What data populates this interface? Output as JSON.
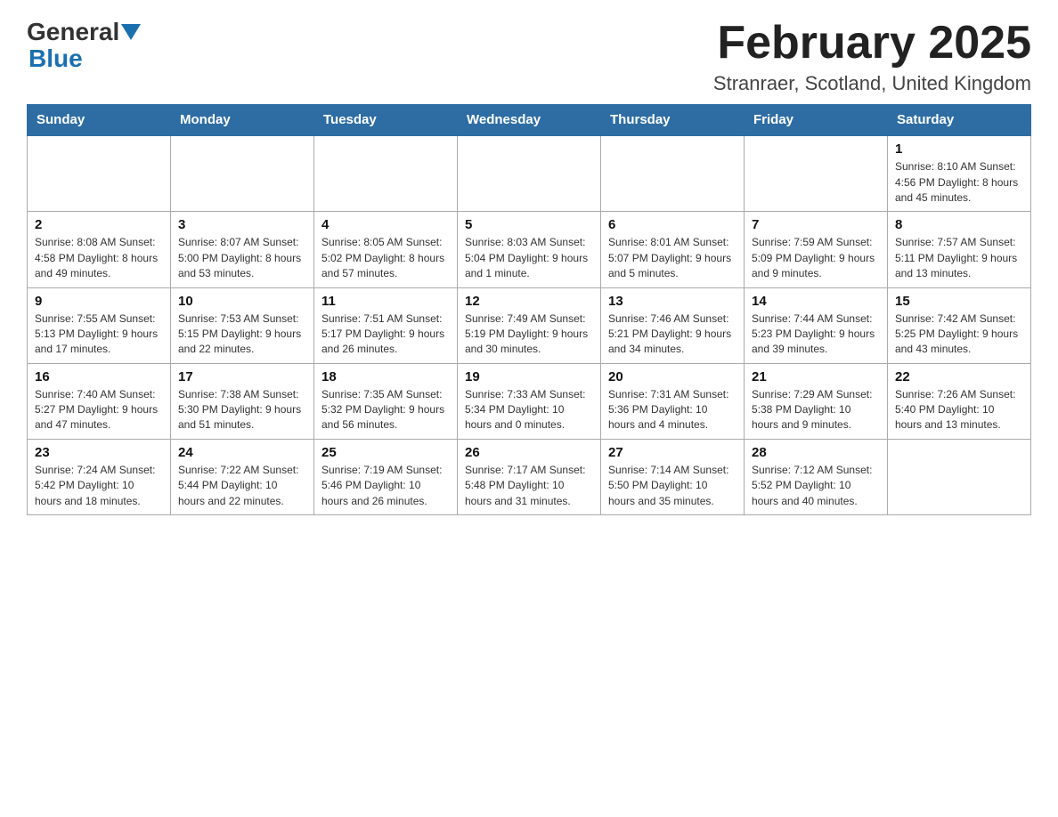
{
  "header": {
    "logo_general": "General",
    "logo_blue": "Blue",
    "title": "February 2025",
    "subtitle": "Stranraer, Scotland, United Kingdom"
  },
  "days_of_week": [
    "Sunday",
    "Monday",
    "Tuesday",
    "Wednesday",
    "Thursday",
    "Friday",
    "Saturday"
  ],
  "weeks": [
    [
      {
        "day": "",
        "info": ""
      },
      {
        "day": "",
        "info": ""
      },
      {
        "day": "",
        "info": ""
      },
      {
        "day": "",
        "info": ""
      },
      {
        "day": "",
        "info": ""
      },
      {
        "day": "",
        "info": ""
      },
      {
        "day": "1",
        "info": "Sunrise: 8:10 AM\nSunset: 4:56 PM\nDaylight: 8 hours and 45 minutes."
      }
    ],
    [
      {
        "day": "2",
        "info": "Sunrise: 8:08 AM\nSunset: 4:58 PM\nDaylight: 8 hours and 49 minutes."
      },
      {
        "day": "3",
        "info": "Sunrise: 8:07 AM\nSunset: 5:00 PM\nDaylight: 8 hours and 53 minutes."
      },
      {
        "day": "4",
        "info": "Sunrise: 8:05 AM\nSunset: 5:02 PM\nDaylight: 8 hours and 57 minutes."
      },
      {
        "day": "5",
        "info": "Sunrise: 8:03 AM\nSunset: 5:04 PM\nDaylight: 9 hours and 1 minute."
      },
      {
        "day": "6",
        "info": "Sunrise: 8:01 AM\nSunset: 5:07 PM\nDaylight: 9 hours and 5 minutes."
      },
      {
        "day": "7",
        "info": "Sunrise: 7:59 AM\nSunset: 5:09 PM\nDaylight: 9 hours and 9 minutes."
      },
      {
        "day": "8",
        "info": "Sunrise: 7:57 AM\nSunset: 5:11 PM\nDaylight: 9 hours and 13 minutes."
      }
    ],
    [
      {
        "day": "9",
        "info": "Sunrise: 7:55 AM\nSunset: 5:13 PM\nDaylight: 9 hours and 17 minutes."
      },
      {
        "day": "10",
        "info": "Sunrise: 7:53 AM\nSunset: 5:15 PM\nDaylight: 9 hours and 22 minutes."
      },
      {
        "day": "11",
        "info": "Sunrise: 7:51 AM\nSunset: 5:17 PM\nDaylight: 9 hours and 26 minutes."
      },
      {
        "day": "12",
        "info": "Sunrise: 7:49 AM\nSunset: 5:19 PM\nDaylight: 9 hours and 30 minutes."
      },
      {
        "day": "13",
        "info": "Sunrise: 7:46 AM\nSunset: 5:21 PM\nDaylight: 9 hours and 34 minutes."
      },
      {
        "day": "14",
        "info": "Sunrise: 7:44 AM\nSunset: 5:23 PM\nDaylight: 9 hours and 39 minutes."
      },
      {
        "day": "15",
        "info": "Sunrise: 7:42 AM\nSunset: 5:25 PM\nDaylight: 9 hours and 43 minutes."
      }
    ],
    [
      {
        "day": "16",
        "info": "Sunrise: 7:40 AM\nSunset: 5:27 PM\nDaylight: 9 hours and 47 minutes."
      },
      {
        "day": "17",
        "info": "Sunrise: 7:38 AM\nSunset: 5:30 PM\nDaylight: 9 hours and 51 minutes."
      },
      {
        "day": "18",
        "info": "Sunrise: 7:35 AM\nSunset: 5:32 PM\nDaylight: 9 hours and 56 minutes."
      },
      {
        "day": "19",
        "info": "Sunrise: 7:33 AM\nSunset: 5:34 PM\nDaylight: 10 hours and 0 minutes."
      },
      {
        "day": "20",
        "info": "Sunrise: 7:31 AM\nSunset: 5:36 PM\nDaylight: 10 hours and 4 minutes."
      },
      {
        "day": "21",
        "info": "Sunrise: 7:29 AM\nSunset: 5:38 PM\nDaylight: 10 hours and 9 minutes."
      },
      {
        "day": "22",
        "info": "Sunrise: 7:26 AM\nSunset: 5:40 PM\nDaylight: 10 hours and 13 minutes."
      }
    ],
    [
      {
        "day": "23",
        "info": "Sunrise: 7:24 AM\nSunset: 5:42 PM\nDaylight: 10 hours and 18 minutes."
      },
      {
        "day": "24",
        "info": "Sunrise: 7:22 AM\nSunset: 5:44 PM\nDaylight: 10 hours and 22 minutes."
      },
      {
        "day": "25",
        "info": "Sunrise: 7:19 AM\nSunset: 5:46 PM\nDaylight: 10 hours and 26 minutes."
      },
      {
        "day": "26",
        "info": "Sunrise: 7:17 AM\nSunset: 5:48 PM\nDaylight: 10 hours and 31 minutes."
      },
      {
        "day": "27",
        "info": "Sunrise: 7:14 AM\nSunset: 5:50 PM\nDaylight: 10 hours and 35 minutes."
      },
      {
        "day": "28",
        "info": "Sunrise: 7:12 AM\nSunset: 5:52 PM\nDaylight: 10 hours and 40 minutes."
      },
      {
        "day": "",
        "info": ""
      }
    ]
  ]
}
